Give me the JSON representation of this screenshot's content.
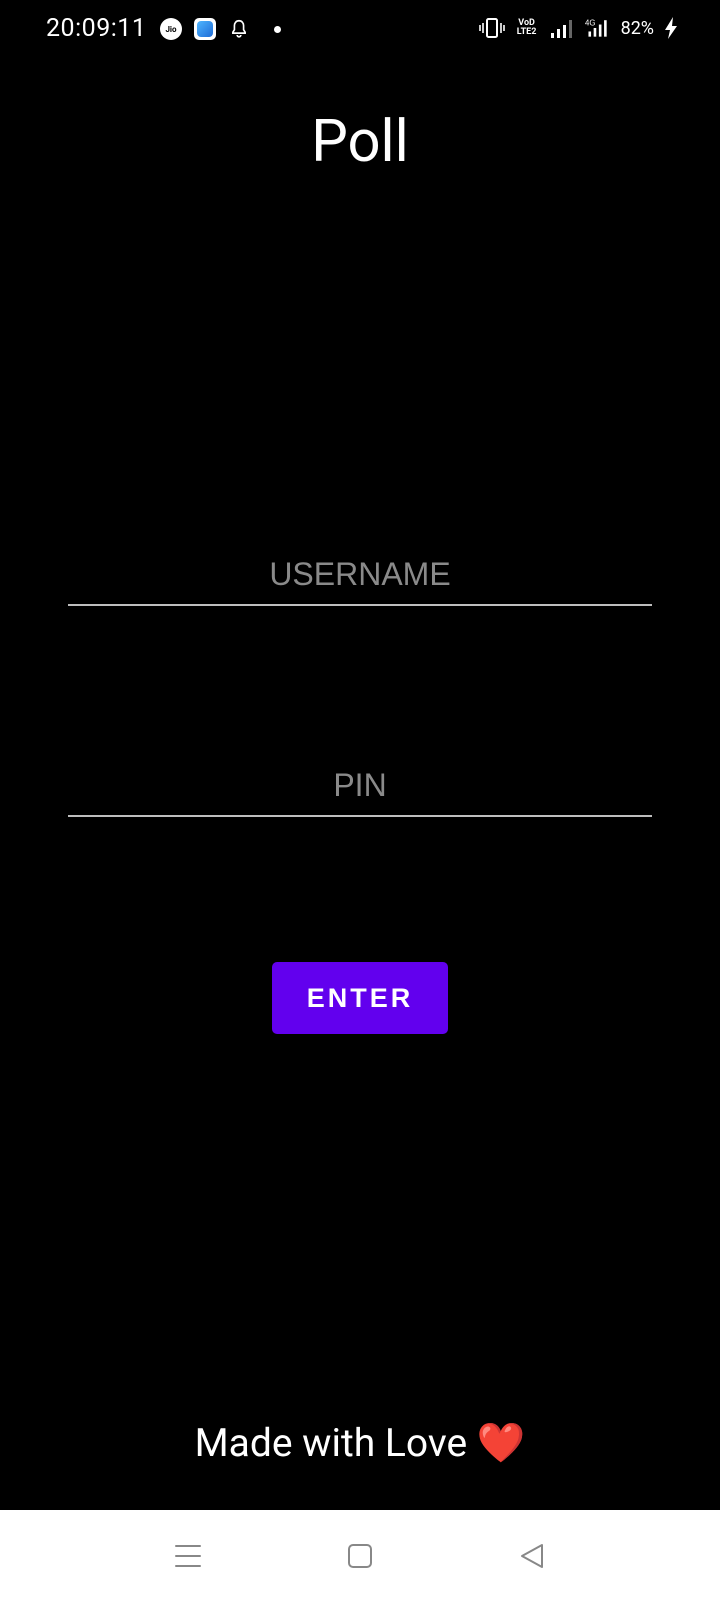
{
  "status_bar": {
    "time": "20:09:11",
    "carrier_badge": "Jio",
    "volte_top": "VoD",
    "volte_bottom": "LTE2",
    "network_type": "4G",
    "battery": "82%",
    "icons": [
      "jio-icon",
      "app-icon",
      "bell-icon",
      "dot-icon",
      "vibrate-icon",
      "volte-icon",
      "signal-icon",
      "signal-4g-icon",
      "charging-icon"
    ]
  },
  "app": {
    "title": "Poll"
  },
  "form": {
    "username": {
      "placeholder": "USERNAME",
      "value": ""
    },
    "pin": {
      "placeholder": "PIN",
      "value": ""
    },
    "submit_label": "ENTER"
  },
  "footer": {
    "text": "Made with Love",
    "emoji": "❤️"
  },
  "nav_bar": {
    "icons": [
      "menu-icon",
      "home-icon",
      "back-icon"
    ]
  },
  "colors": {
    "background": "#000000",
    "accent": "#6200ee",
    "text": "#ffffff",
    "placeholder": "#8a8a8a"
  }
}
